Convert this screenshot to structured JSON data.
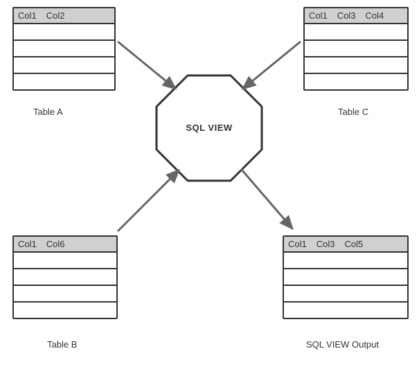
{
  "tables": {
    "a": {
      "cols": [
        "Col1",
        "Col2"
      ],
      "caption": "Table A"
    },
    "c": {
      "cols": [
        "Col1",
        "Col3",
        "Col4"
      ],
      "caption": "Table C"
    },
    "b": {
      "cols": [
        "Col1",
        "Col6"
      ],
      "caption": "Table B"
    },
    "out": {
      "cols": [
        "Col1",
        "Col3",
        "Col5"
      ],
      "caption": "SQL VIEW Output"
    }
  },
  "center": {
    "label": "SQL VIEW"
  }
}
